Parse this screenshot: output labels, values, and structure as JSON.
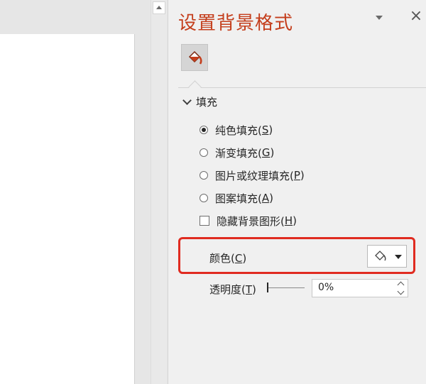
{
  "pane": {
    "title": "设置背景格式",
    "menu_icon": "chevron-down-icon",
    "close_glyph": "×",
    "tab_icon": "paint-bucket-icon"
  },
  "fill_section": {
    "header": "填充",
    "options": [
      {
        "text": "纯色填充(",
        "key": "S",
        "end": ")",
        "type": "radio",
        "checked": true
      },
      {
        "text": "渐变填充(",
        "key": "G",
        "end": ")",
        "type": "radio",
        "checked": false
      },
      {
        "text": "图片或纹理填充(",
        "key": "P",
        "end": ")",
        "type": "radio",
        "checked": false
      },
      {
        "text": "图案填充(",
        "key": "A",
        "end": ")",
        "type": "radio",
        "checked": false
      },
      {
        "text": "隐藏背景图形(",
        "key": "H",
        "end": ")",
        "type": "checkbox",
        "checked": false
      }
    ]
  },
  "color": {
    "label_text": "颜色(",
    "key": "C",
    "end": ")"
  },
  "transparency": {
    "label_text": "透明度(",
    "key": "T",
    "end": ")",
    "value": "0%"
  },
  "colors": {
    "title": "#c43e1c",
    "highlight": "#e02b20",
    "bucket": "#c43e1c"
  }
}
